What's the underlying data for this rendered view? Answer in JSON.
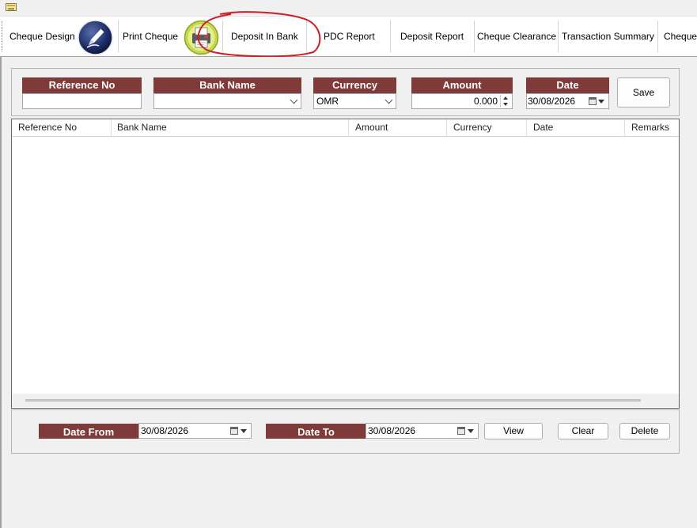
{
  "toolbar": {
    "items": [
      {
        "label": "Cheque Design"
      },
      {
        "label": "Print Cheque"
      },
      {
        "label": "Deposit In Bank"
      },
      {
        "label": "PDC Report"
      },
      {
        "label": "Deposit Report"
      },
      {
        "label": "Cheque Clearance"
      },
      {
        "label": "Transaction Summary"
      },
      {
        "label": "Cheque"
      }
    ],
    "icons": {
      "design": "pen-icon",
      "print": "printer-icon"
    },
    "highlight_color": "#cc1f26"
  },
  "form": {
    "reference_no": {
      "label": "Reference No",
      "value": ""
    },
    "bank_name": {
      "label": "Bank Name",
      "value": ""
    },
    "currency": {
      "label": "Currency",
      "value": "OMR"
    },
    "amount": {
      "label": "Amount",
      "value": "0.000"
    },
    "date": {
      "label": "Date",
      "value": "30/08/2026"
    },
    "save_label": "Save",
    "header_color": "#7f3a3a"
  },
  "grid": {
    "columns": [
      "Reference No",
      "Bank Name",
      "Amount",
      "Currency",
      "Date",
      "Remarks"
    ],
    "rows": []
  },
  "filter": {
    "date_from": {
      "label": "Date From",
      "value": "30/08/2026"
    },
    "date_to": {
      "label": "Date To",
      "value": "30/08/2026"
    },
    "view_label": "View",
    "clear_label": "Clear",
    "delete_label": "Delete"
  }
}
